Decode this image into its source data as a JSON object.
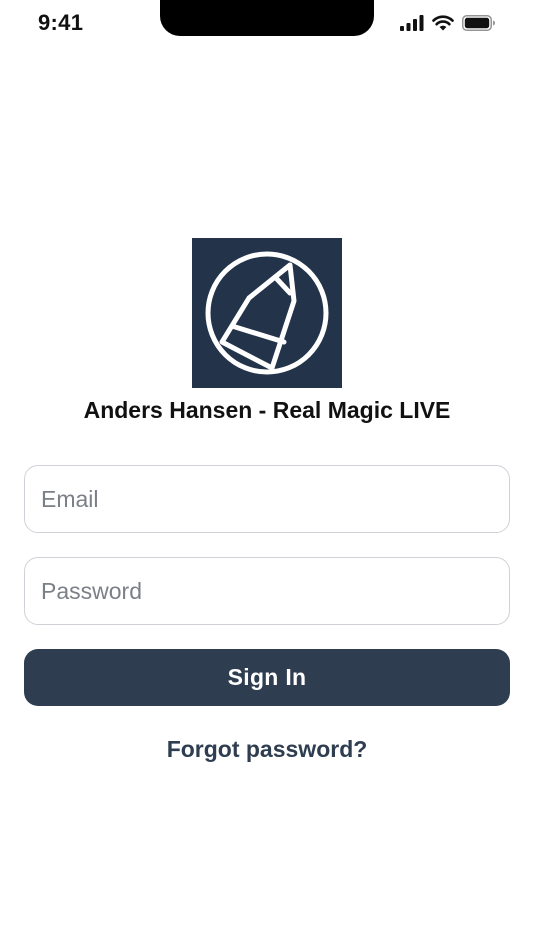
{
  "status_bar": {
    "time": "9:41"
  },
  "app": {
    "logo_icon": "pen-nib-circle-icon",
    "title": "Anders Hansen - Real Magic LIVE"
  },
  "form": {
    "email_placeholder": "Email",
    "email_value": "",
    "password_placeholder": "Password",
    "password_value": "",
    "sign_in_label": "Sign In",
    "forgot_password_label": "Forgot password?"
  },
  "colors": {
    "logo_background": "#22334a",
    "primary_button": "#2e3d50",
    "link_text": "#2e3d50",
    "field_border": "#cfd3d8",
    "placeholder_text": "#7b7f86"
  }
}
